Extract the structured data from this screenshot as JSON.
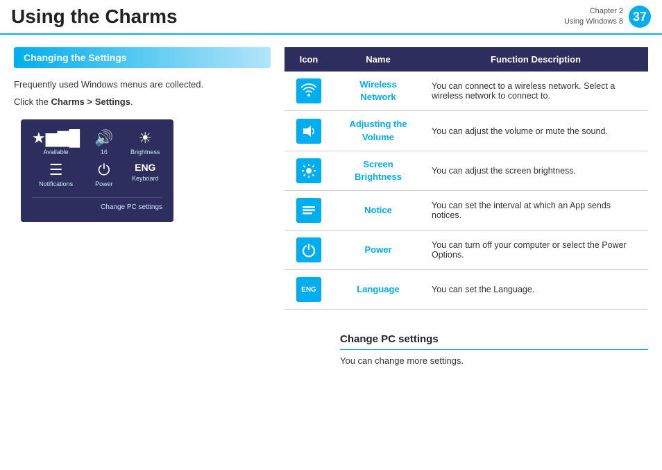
{
  "header": {
    "title": "Using the Charms",
    "chapter_label": "Chapter 2",
    "chapter_sublabel": "Using Windows 8",
    "page_number": "37"
  },
  "left": {
    "section_title": "Changing the Settings",
    "intro_line1": "Frequently used Windows menus are collected.",
    "intro_line2_plain": "Click the ",
    "intro_line2_bold": "Charms > Settings",
    "intro_line2_end": ".",
    "charm": {
      "items": [
        {
          "icon": "📶",
          "label": "Available"
        },
        {
          "icon": "🔊",
          "label": "16"
        },
        {
          "icon": "☀",
          "label": "Brightness"
        },
        {
          "icon": "☰",
          "label": "Notifications"
        },
        {
          "icon": "⏻",
          "label": "Power"
        },
        {
          "icon": "ENG",
          "label": "Keyboard"
        }
      ],
      "footer": "Change PC settings"
    }
  },
  "table": {
    "columns": [
      "Icon",
      "Name",
      "Function Description"
    ],
    "rows": [
      {
        "icon_type": "wifi",
        "icon_symbol": "📶",
        "name": "Wireless\nNetwork",
        "description": "You can connect to a wireless network. Select a wireless network to connect to."
      },
      {
        "icon_type": "volume",
        "icon_symbol": "🔊",
        "name": "Adjusting the\nVolume",
        "description": "You can adjust the volume or mute the sound."
      },
      {
        "icon_type": "brightness",
        "icon_symbol": "☀",
        "name": "Screen\nBrightness",
        "description": "You can adjust the screen brightness."
      },
      {
        "icon_type": "notice",
        "icon_symbol": "≡",
        "name": "Notice",
        "description": "You can set the interval at which an App sends notices."
      },
      {
        "icon_type": "power",
        "icon_symbol": "⏻",
        "name": "Power",
        "description": "You can turn off your computer or select the Power Options."
      },
      {
        "icon_type": "language",
        "icon_symbol": "ENG",
        "name": "Language",
        "description": "You can set the Language."
      }
    ]
  },
  "bottom": {
    "change_pc_title": "Change PC settings",
    "change_pc_text": "You can change more settings."
  }
}
